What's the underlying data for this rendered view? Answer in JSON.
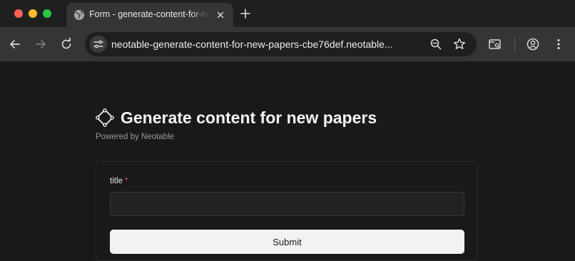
{
  "browser": {
    "tab": {
      "title": "Form - generate-content-for-new-papers"
    },
    "address_bar": {
      "url": "neotable-generate-content-for-new-papers-cbe76def.neotable..."
    }
  },
  "form": {
    "title": "Generate content for new papers",
    "powered_by": "Powered by Neotable",
    "fields": [
      {
        "label": "title",
        "required_mark": "*",
        "value": ""
      }
    ],
    "submit_label": "Submit"
  }
}
